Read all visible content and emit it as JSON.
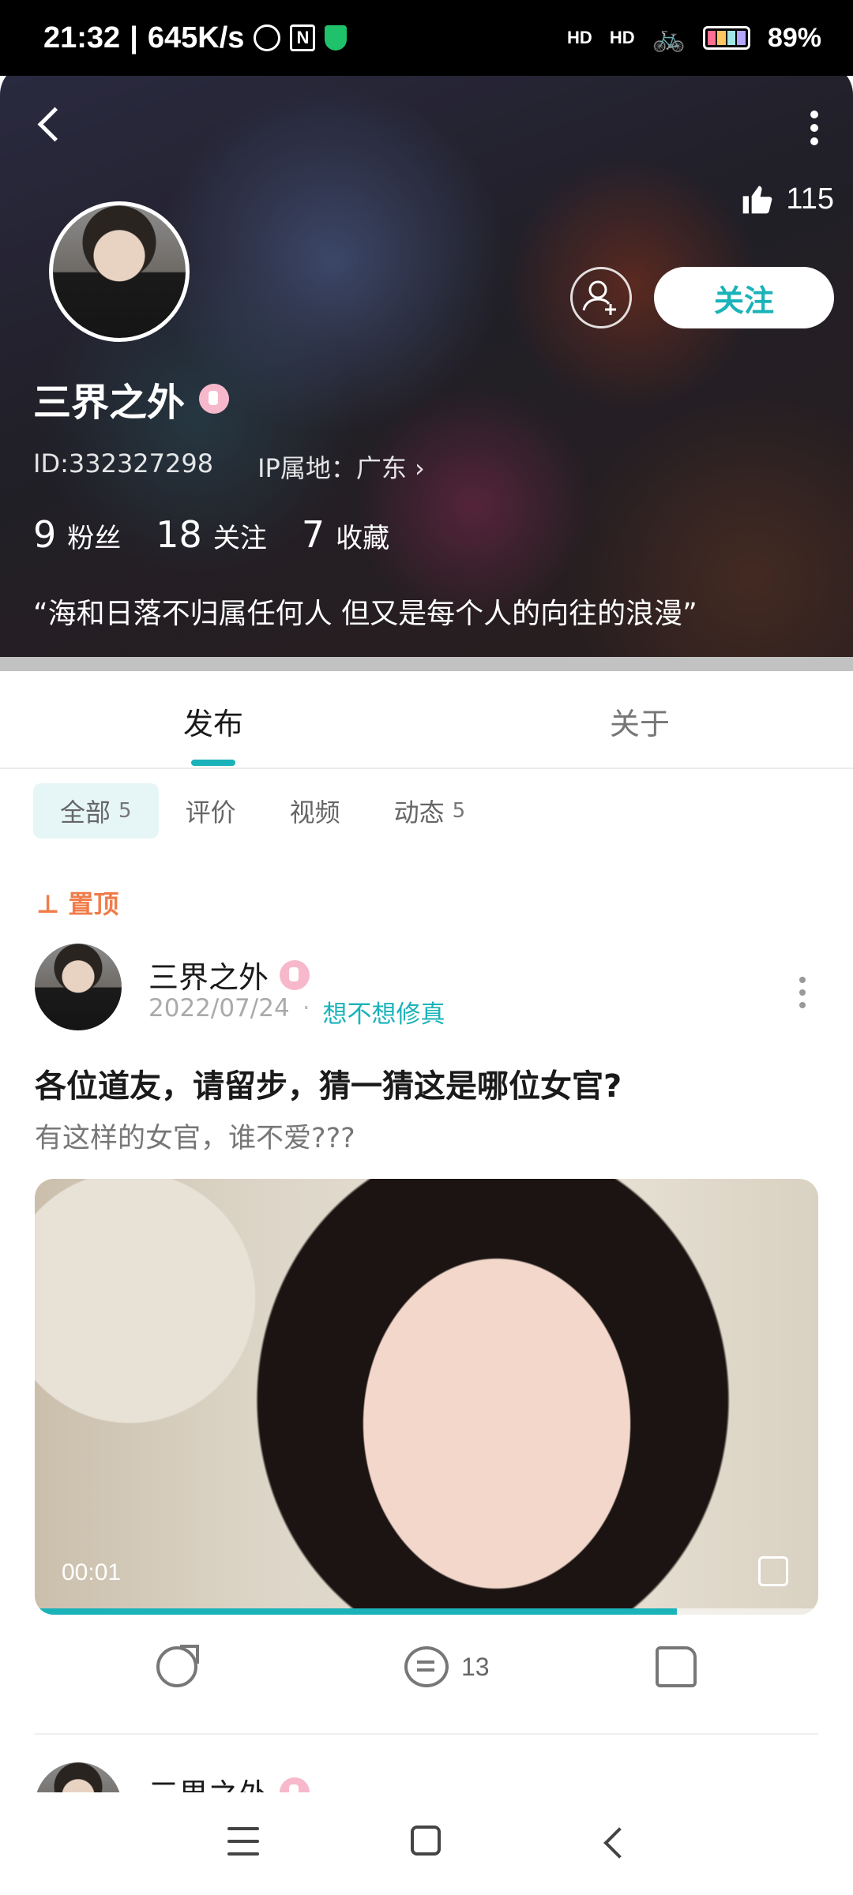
{
  "status_bar": {
    "time": "21:32",
    "network_speed": "645K/s",
    "network_1": "HD",
    "network_2": "HD",
    "battery": "89%"
  },
  "profile": {
    "likes": "115",
    "follow_label": "关注",
    "name": "三界之外",
    "id": "ID:332327298",
    "ip_location": "IP属地：广东",
    "stats": [
      {
        "num": "9",
        "label": "粉丝"
      },
      {
        "num": "18",
        "label": "关注"
      },
      {
        "num": "7",
        "label": "收藏"
      }
    ],
    "bio": "“海和日落不归属任何人 但又是每个人的向往的浪漫”"
  },
  "tabs": {
    "publish": "发布",
    "about": "关于"
  },
  "filters": [
    {
      "label": "全部",
      "count": "5"
    },
    {
      "label": "评价",
      "count": ""
    },
    {
      "label": "视频",
      "count": ""
    },
    {
      "label": "动态",
      "count": "5"
    }
  ],
  "pinned_label": "置顶",
  "post": {
    "author": "三界之外",
    "date": "2022/07/24",
    "topic": "想不想修真",
    "title": "各位道友，请留步，猜一猜这是哪位女官?",
    "subtitle": "有这样的女官，谁不爱???",
    "video_time": "00:01",
    "video_progress": 0.82,
    "comments": "13"
  },
  "next_post": {
    "author": "三界之外"
  },
  "colors": {
    "accent": "#1ab3b9",
    "pinned": "#f07c4a"
  }
}
